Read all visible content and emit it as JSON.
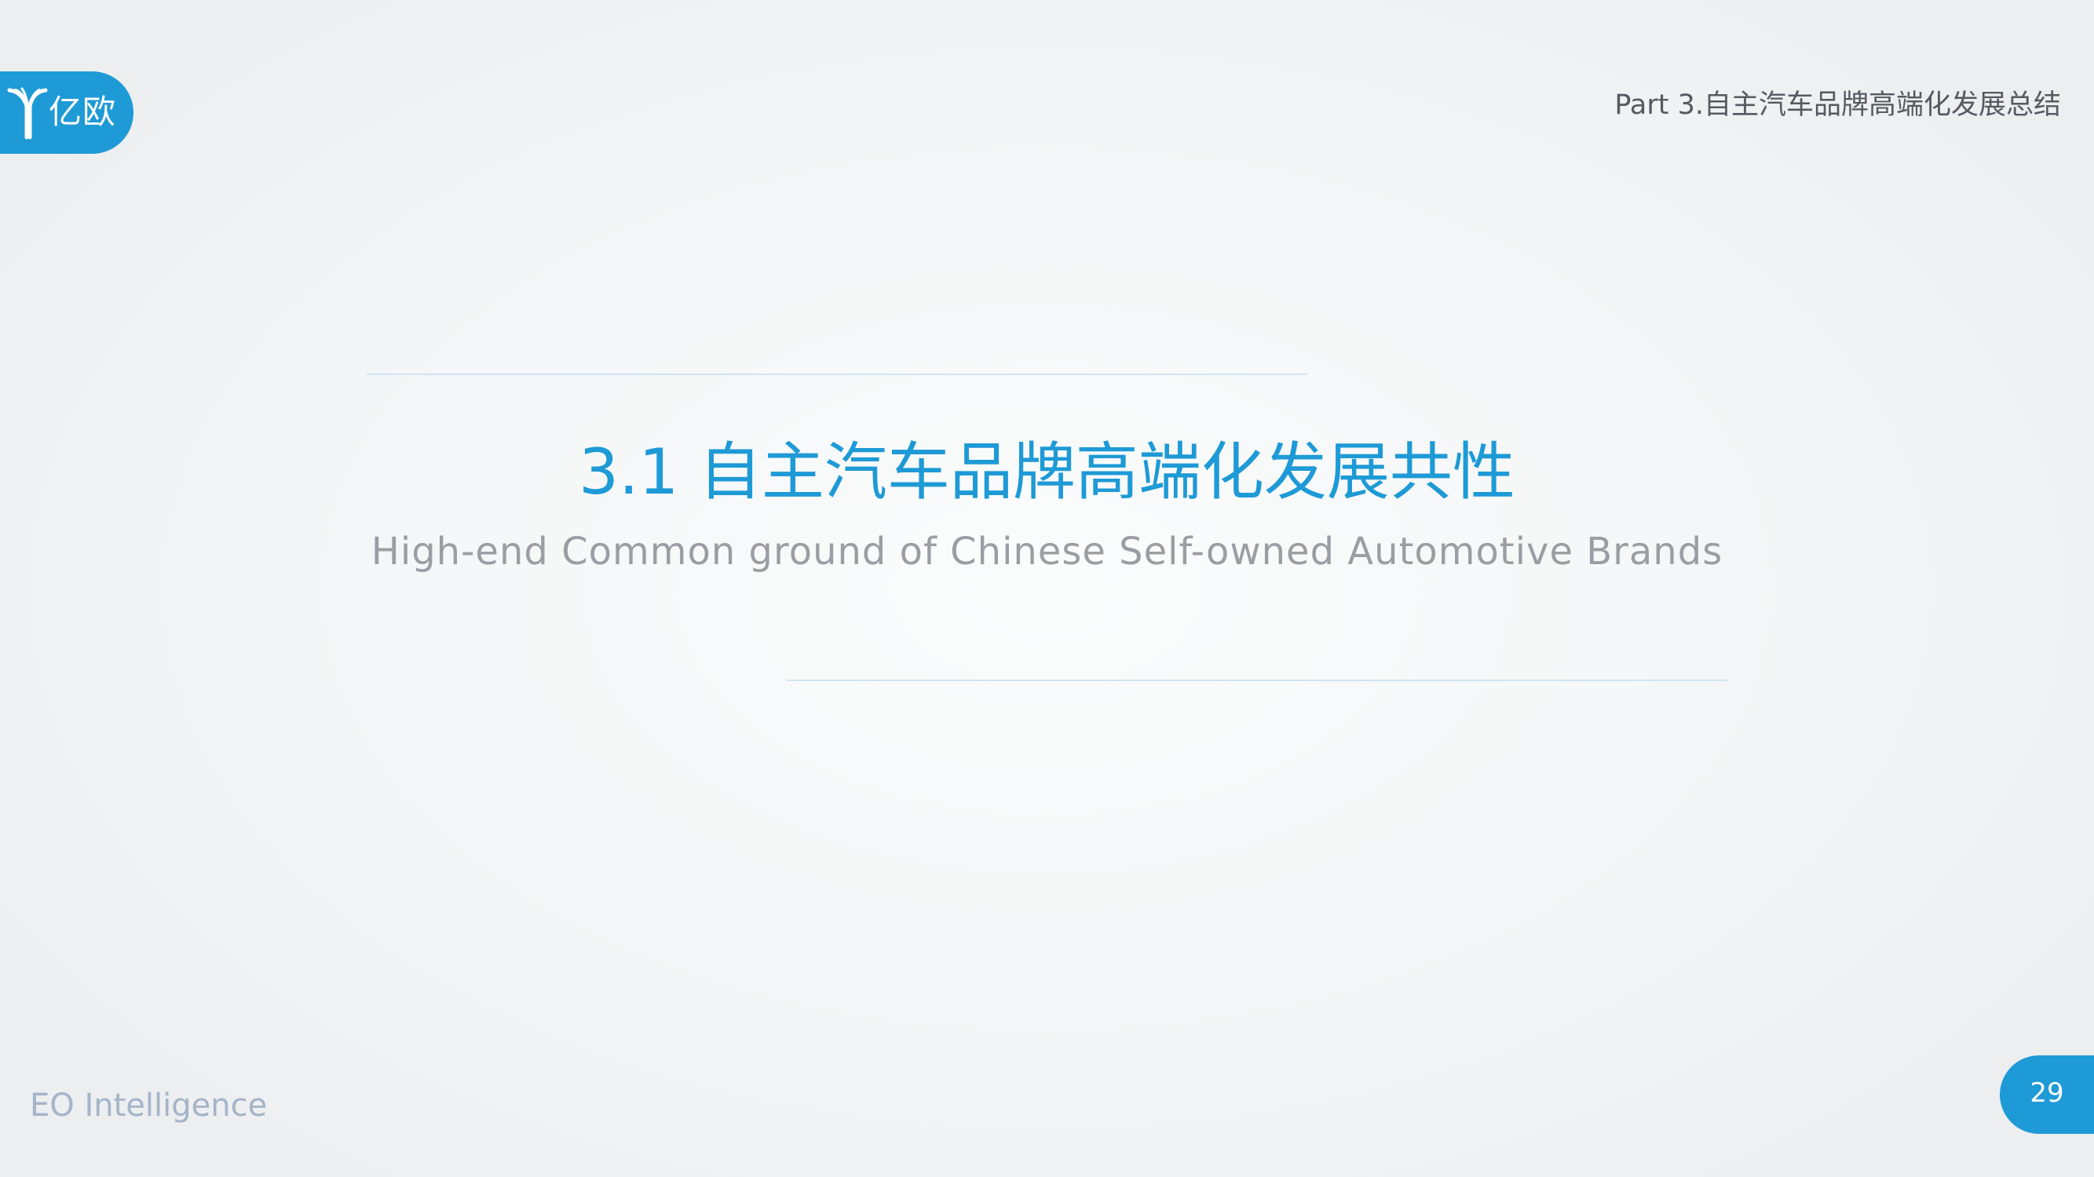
{
  "logo": {
    "icon": "eo-y-logo-icon",
    "text": "亿欧"
  },
  "header": {
    "part_label": "Part 3.自主汽车品牌高端化发展总结"
  },
  "section": {
    "title": "3.1 自主汽车品牌高端化发展共性",
    "subtitle": "High-end Common ground of Chinese Self-owned Automotive Brands"
  },
  "footer": {
    "brand": "EO Intelligence",
    "page_number": "29"
  },
  "colors": {
    "accent": "#1e9ad6",
    "subtitle_gray": "#9a9ea3",
    "header_gray": "#555a60",
    "footer_text": "#a4b4c8",
    "rule": "#cfe5f2"
  }
}
